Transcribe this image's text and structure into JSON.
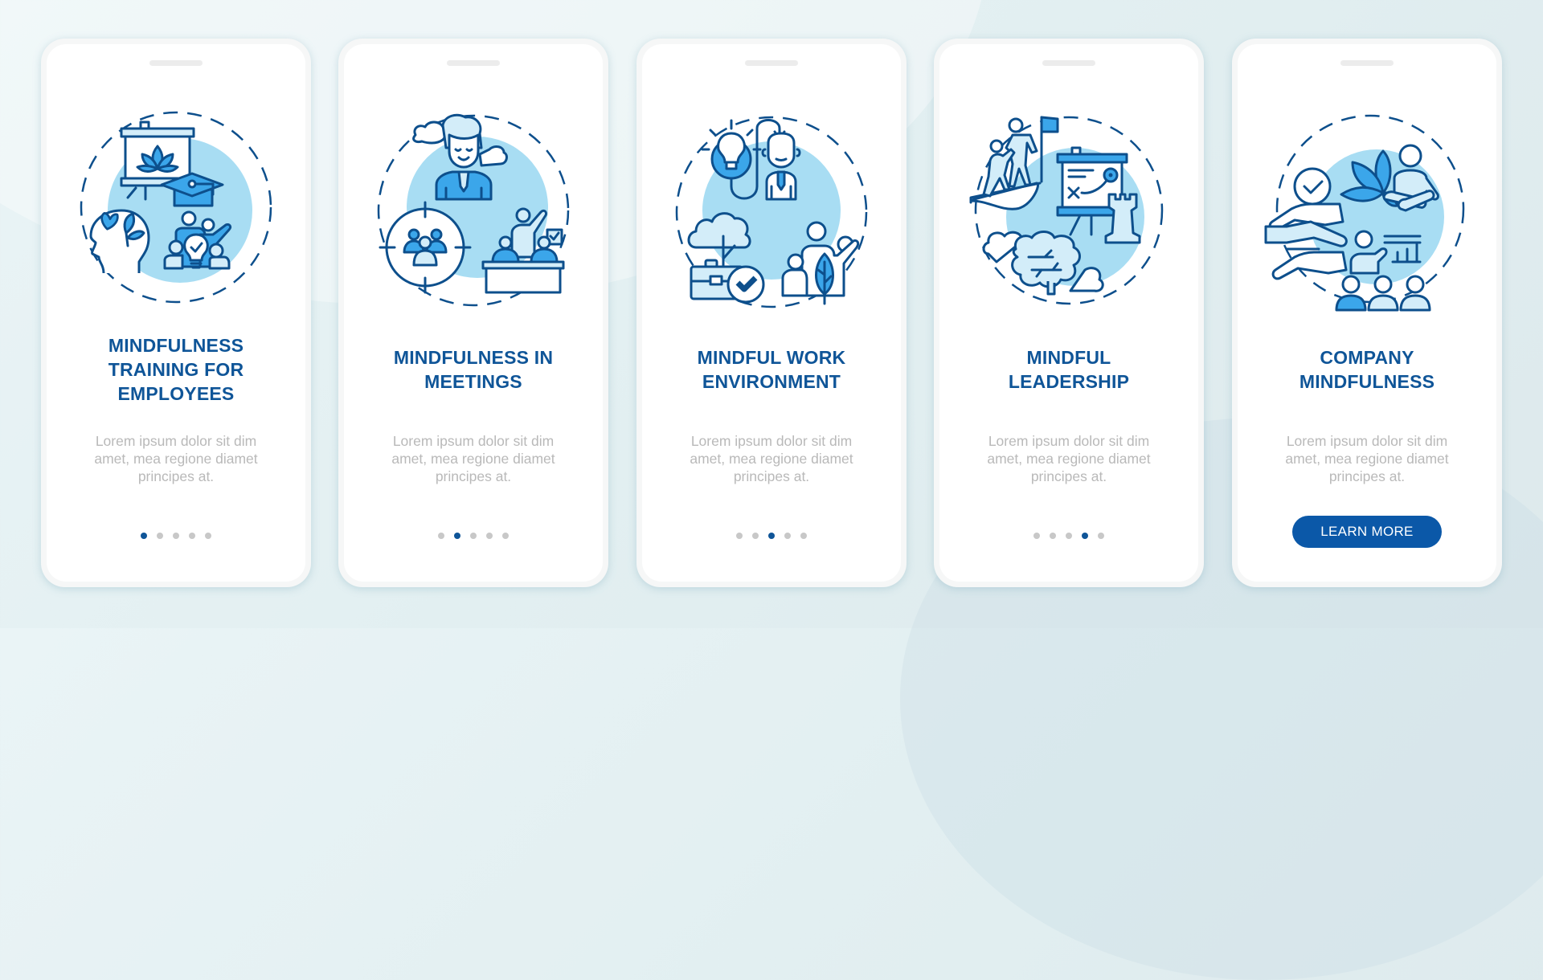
{
  "colors": {
    "title": "#0f5598",
    "body_text": "#b9b9b9",
    "dot_inactive": "#c8c8c8",
    "dot_active": "#0f5598",
    "button_bg": "#0b58a8",
    "illustration_stroke": "#0d4f8c",
    "illustration_fill": "#3ba6ea",
    "illustration_circle": "#a8ddf3",
    "background": "#e3eff1"
  },
  "screens": [
    {
      "title": "MINDFULNESS\nTRAINING FOR\nEMPLOYEES",
      "body": "Lorem ipsum dolor sit dim\namet, mea regione diamet\nprincipes at.",
      "illustration": "mindfulness-training-illustration",
      "dots": 5,
      "active_dot": 1
    },
    {
      "title": "MINDFULNESS IN\nMEETINGS",
      "body": "Lorem ipsum dolor sit dim\namet, mea regione diamet\nprincipes at.",
      "illustration": "mindful-meetings-illustration",
      "dots": 5,
      "active_dot": 2
    },
    {
      "title": "MINDFUL WORK\nENVIRONMENT",
      "body": "Lorem ipsum dolor sit dim\namet, mea regione diamet\nprincipes at.",
      "illustration": "mindful-work-environment-illustration",
      "dots": 5,
      "active_dot": 3
    },
    {
      "title": "MINDFUL\nLEADERSHIP",
      "body": "Lorem ipsum dolor sit dim\namet, mea regione diamet\nprincipes at.",
      "illustration": "mindful-leadership-illustration",
      "dots": 5,
      "active_dot": 4
    },
    {
      "title": "COMPANY\nMINDFULNESS",
      "body": "Lorem ipsum dolor sit dim\namet, mea regione diamet\nprincipes at.",
      "illustration": "company-mindfulness-illustration",
      "button_label": "LEARN MORE"
    }
  ]
}
